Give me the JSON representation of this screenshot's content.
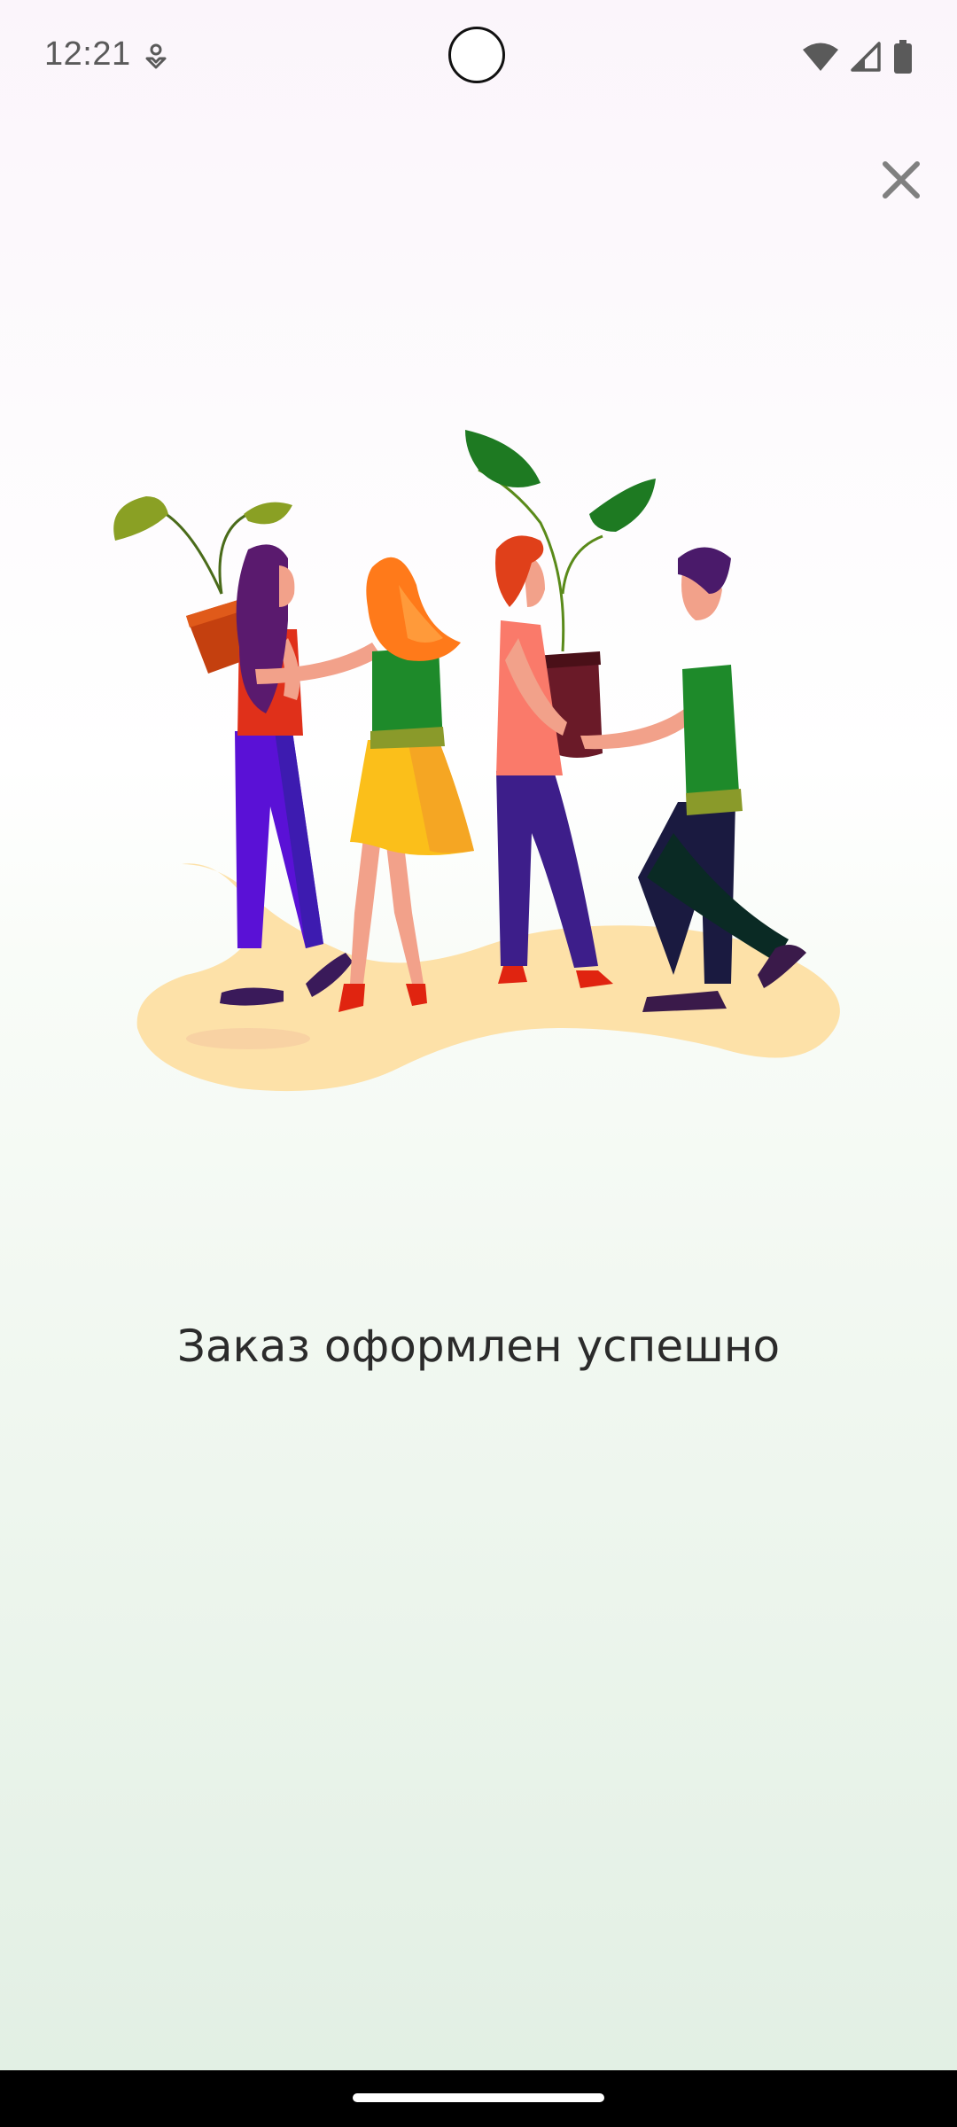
{
  "status_bar": {
    "time": "12:21",
    "icons": [
      "notification-icon",
      "wifi-icon",
      "signal-icon",
      "battery-icon"
    ]
  },
  "close_icon": "close-icon",
  "illustration": "people-exchanging-plants-illustration",
  "message": "Заказ оформлен успешно",
  "colors": {
    "background_top": "#fbf5fb",
    "background_bottom": "#e1efe3",
    "text": "#2b2b2b",
    "icon_gray": "#808080"
  }
}
